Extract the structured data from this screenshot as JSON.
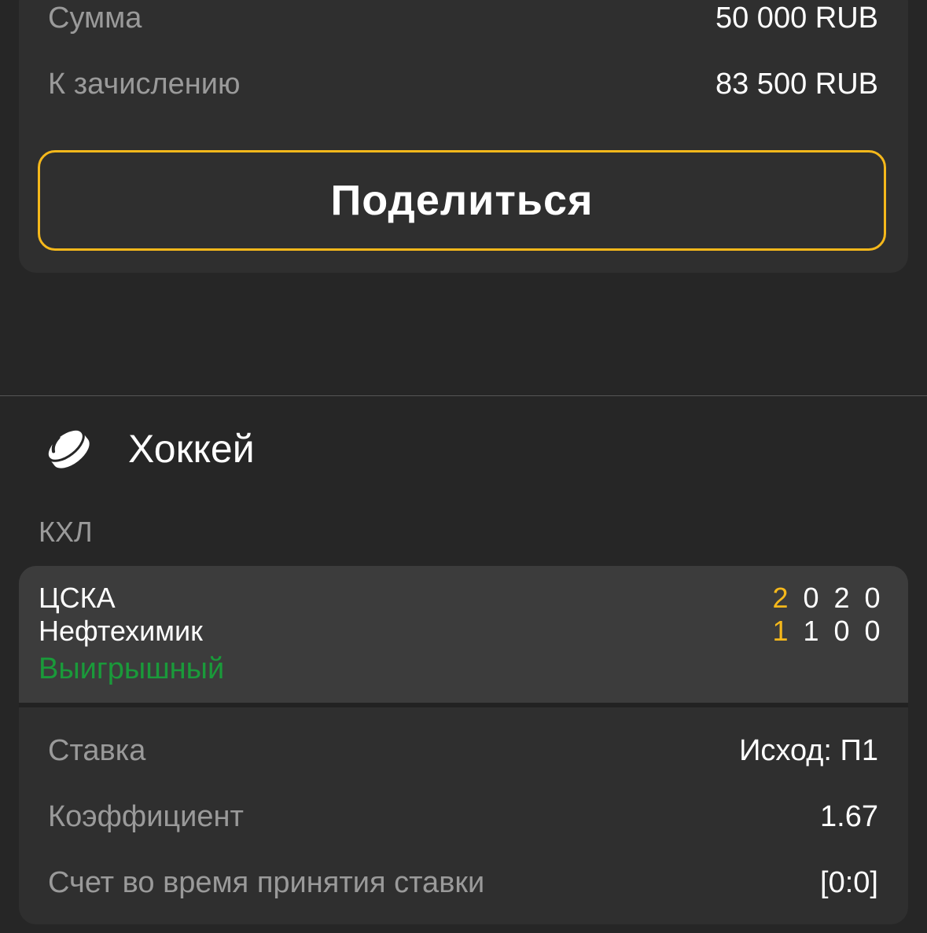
{
  "summary": {
    "sum_label": "Сумма",
    "sum_value": "50 000 RUB",
    "payout_label": "К зачислению",
    "payout_value": "83 500 RUB",
    "share_label": "Поделиться"
  },
  "sport": {
    "icon": "hockey-puck-icon",
    "title": "Хоккей"
  },
  "league": "КХЛ",
  "event": {
    "team1": "ЦСКА",
    "team2": "Нефтехимик",
    "status": "Выигрышный",
    "scores1": [
      "2",
      "0",
      "2",
      "0"
    ],
    "scores2": [
      "1",
      "1",
      "0",
      "0"
    ]
  },
  "details": {
    "bet_label": "Ставка",
    "bet_value": "Исход: П1",
    "coef_label": "Коэффициент",
    "coef_value": "1.67",
    "score_label": "Счет во время принятия ставки",
    "score_value": "[0:0]"
  },
  "colors": {
    "accent": "#f5b81b",
    "win": "#1a9a3a",
    "background": "#262626",
    "card": "#2f2f2f",
    "event_card": "#3c3c3c"
  }
}
